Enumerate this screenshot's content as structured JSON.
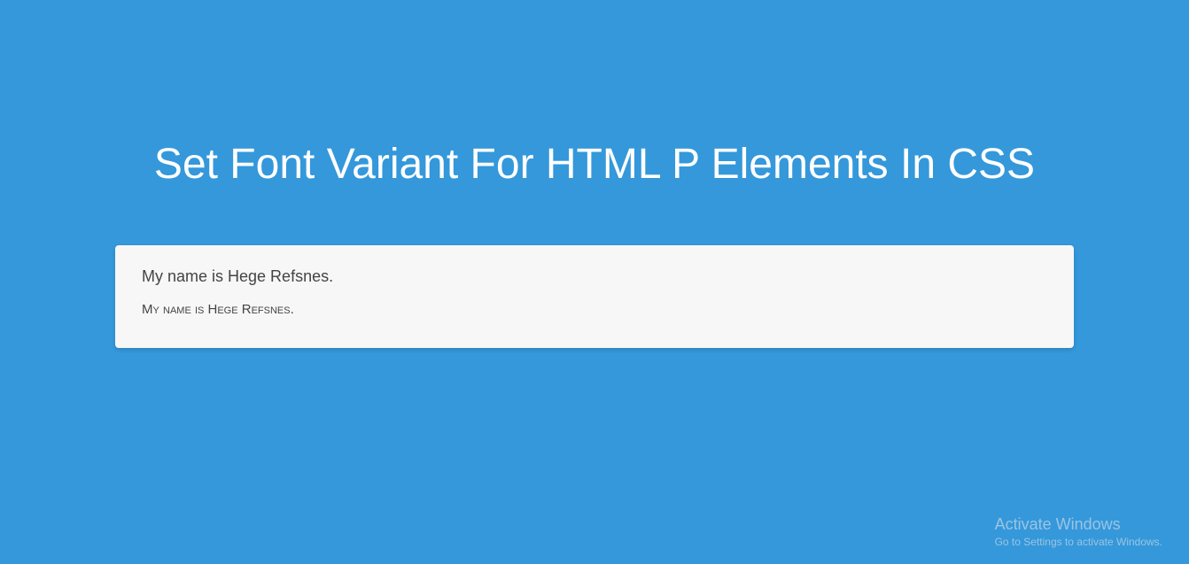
{
  "title": "Set Font Variant For HTML P Elements In CSS",
  "card": {
    "paragraph1": "My name is Hege Refsnes.",
    "paragraph2": "My name is Hege Refsnes."
  },
  "watermark": {
    "title": "Activate Windows",
    "subtitle": "Go to Settings to activate Windows."
  }
}
